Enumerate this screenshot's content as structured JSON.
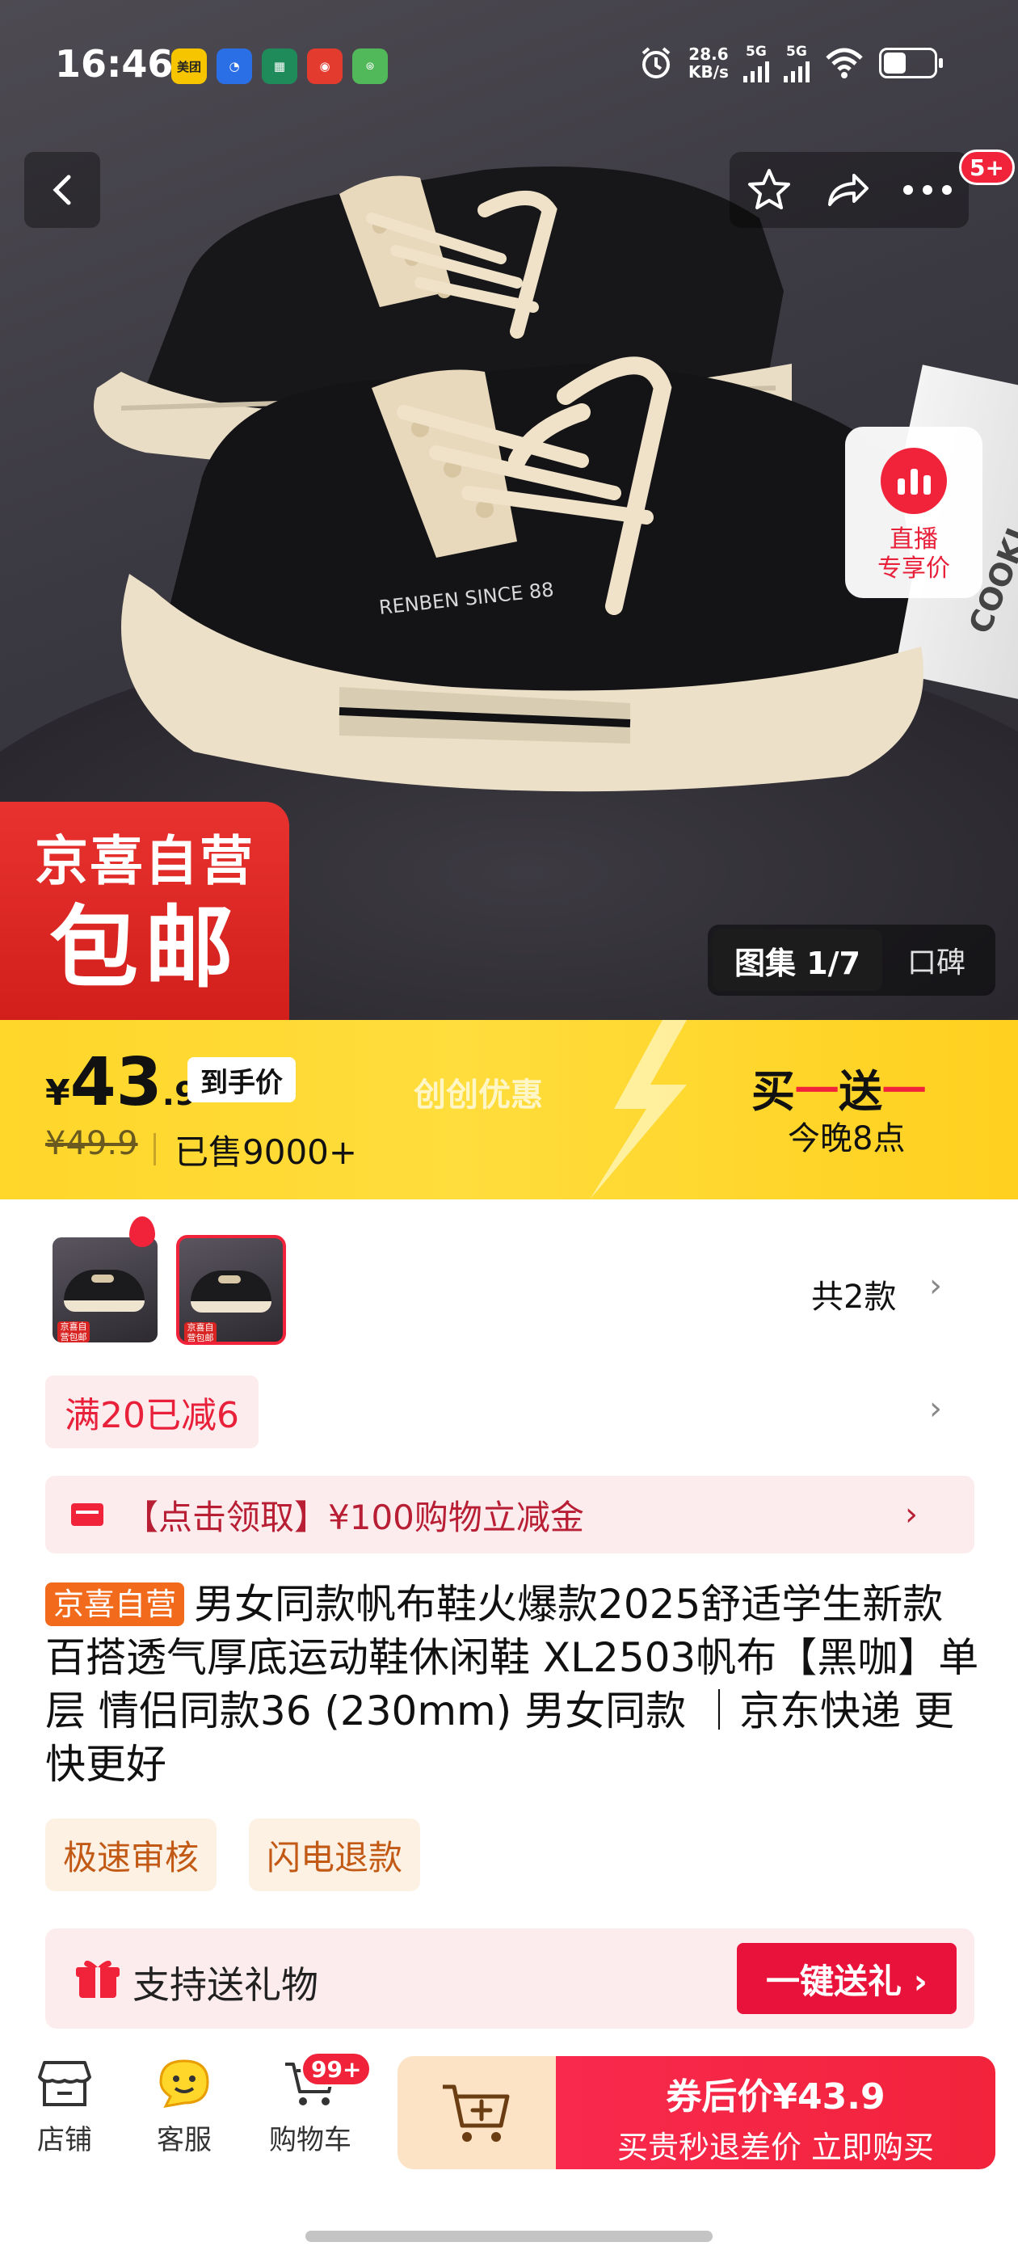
{
  "status_bar": {
    "time": "16:46",
    "app_icons": [
      {
        "name": "meituan-icon",
        "label": "美团",
        "color": "#f6c500"
      },
      {
        "name": "app-blue-icon",
        "label": "",
        "color": "#2b6fe6"
      },
      {
        "name": "app-green-icon",
        "label": "",
        "color": "#1f8a5a"
      },
      {
        "name": "app-red-icon",
        "label": "",
        "color": "#e33b2e"
      },
      {
        "name": "app-lightgreen-icon",
        "label": "",
        "color": "#52b95a"
      }
    ],
    "network_speed_value": "28.6",
    "network_speed_unit": "KB/s",
    "signal1_label": "5G",
    "signal2_label": "5G",
    "battery_level": 0.45
  },
  "hero": {
    "live_card": {
      "line1": "直播",
      "line2": "专享价"
    },
    "notification_count": "5+",
    "jingxi_badge": {
      "line1": "京喜自营",
      "line2": "包邮"
    },
    "gallery_tab": "图集 1/7",
    "review_tab": "口碑",
    "book_text": "COOKI"
  },
  "price_banner": {
    "currency": "¥",
    "price_int": "43",
    "price_dec": ".9",
    "price_tag": "到手价",
    "original_price": "¥49.9",
    "sold": "已售9000+",
    "promo_name": "创创优惠",
    "promo_buy": "买",
    "promo_dash1": "一",
    "promo_send": "送",
    "promo_dash2": "一",
    "promo_time": "今晚8点"
  },
  "sku": {
    "count_text": "共2款",
    "thumb_label": "京喜自营包邮"
  },
  "discount": {
    "text": "满20已减6"
  },
  "coupon": {
    "text": "【点击领取】¥100购物立减金"
  },
  "product": {
    "tag": "京喜自营",
    "title": "男女同款帆布鞋火爆款2025舒适学生新款百搭透气厚底运动鞋休闲鞋 XL2503帆布【黑咖】单层 情侣同款36 (230mm) 男女同款 ｜京东快递 更快更好"
  },
  "services": [
    "极速审核",
    "闪电退款"
  ],
  "gift": {
    "text": "支持送礼物",
    "button": "一键送礼 ›"
  },
  "bottom_bar": {
    "shop": "店铺",
    "service": "客服",
    "cart": "购物车",
    "cart_badge": "99+",
    "buy_line1": "券后价¥43.9",
    "buy_line2": "买贵秒退差价 立即购买"
  },
  "colors": {
    "accent": "#f0233a",
    "price_yellow": "#ffd62a",
    "orange_tag": "#f26a1c"
  }
}
